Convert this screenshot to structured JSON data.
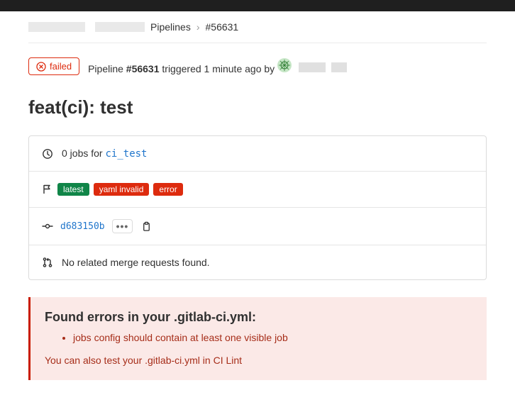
{
  "breadcrumb": {
    "link1": "Pipelines",
    "sep": "›",
    "current": "#56631"
  },
  "header": {
    "status_label": "failed",
    "pipeline_prefix": "Pipeline ",
    "pipeline_id": "#56631",
    "triggered_text": " triggered 1 minute ago by "
  },
  "title": "feat(ci): test",
  "jobs": {
    "count_text": "0 jobs for ",
    "branch": "ci_test"
  },
  "tags": {
    "latest": "latest",
    "yaml_invalid": "yaml invalid",
    "error": "error"
  },
  "commit": {
    "sha": "d683150b",
    "dots": "•••"
  },
  "mr": {
    "text": "No related merge requests found."
  },
  "error_panel": {
    "title": "Found errors in your .gitlab-ci.yml:",
    "items": [
      "jobs config should contain at least one visible job"
    ],
    "footer": "You can also test your .gitlab-ci.yml in CI Lint"
  }
}
